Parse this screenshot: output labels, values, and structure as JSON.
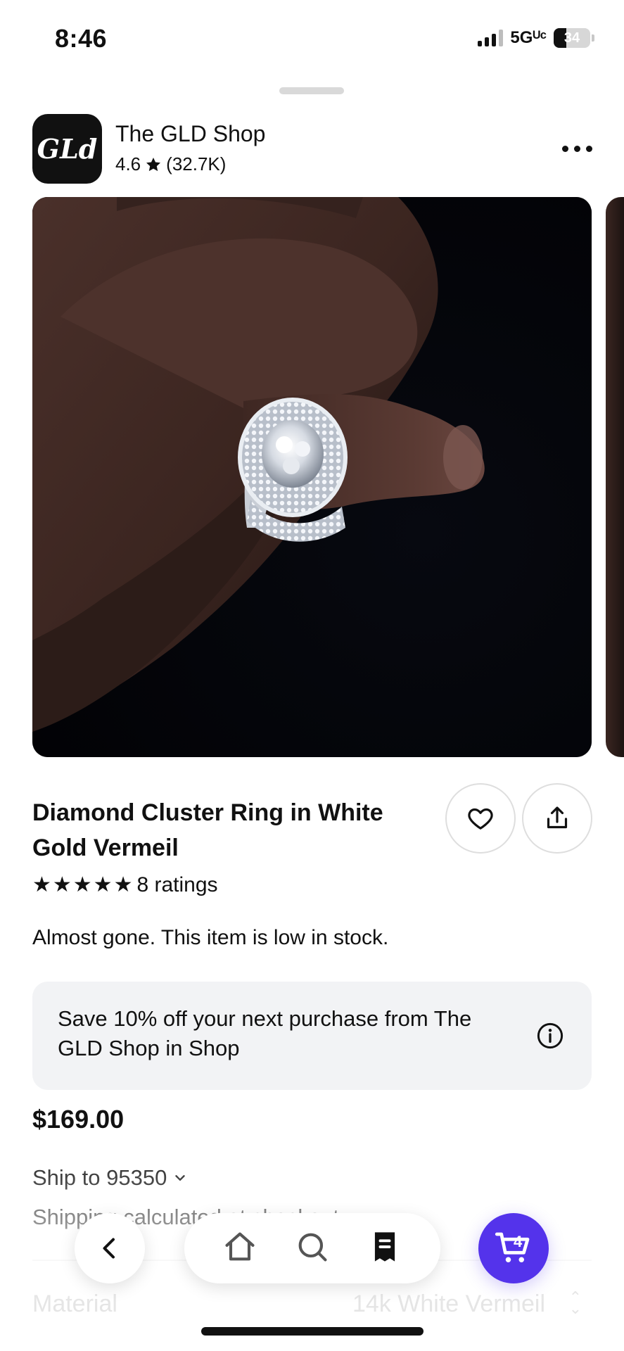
{
  "status_bar": {
    "time": "8:46",
    "network": "5Gᵁᶜ",
    "battery": "34",
    "battery_level": 0.34
  },
  "shop": {
    "logo_text": "GLd",
    "name": "The GLD Shop",
    "rating": "4.6",
    "review_count": "(32.7K)"
  },
  "product": {
    "title": "Diamond Cluster Ring in White Gold Vermeil",
    "rating_stars": 5,
    "ratings_label": "8 ratings",
    "stock_message": "Almost gone. This item is low in stock.",
    "price": "$169.00"
  },
  "promo": {
    "text": "Save 10% off your next purchase from The GLD Shop in Shop"
  },
  "shipping": {
    "ship_to": "Ship to 95350",
    "note": "Shipping calculated at checkout"
  },
  "options": {
    "material_label": "Material",
    "material_value": "14k White Vermeil"
  },
  "bottom_nav": {
    "cart_count": "4"
  },
  "colors": {
    "accent": "#5433eb",
    "promo_bg": "#f2f3f5"
  }
}
